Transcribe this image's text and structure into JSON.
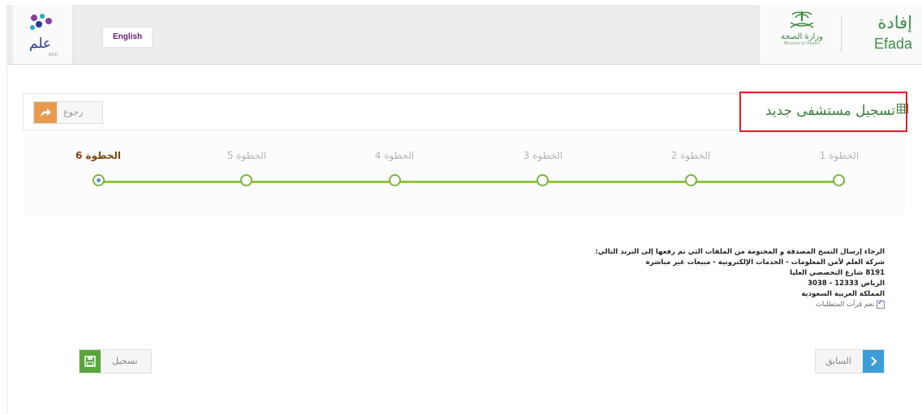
{
  "header": {
    "elm_logo_text": "علم",
    "elm_logo_sub": "elm",
    "language_button": "English",
    "moh_name_ar": "وزارة الصحة",
    "moh_name_en": "Ministry of Health",
    "efada_ar": "إفادة",
    "efada_en": "Efada"
  },
  "panel": {
    "title": "تسجيل مستشفى جديد",
    "back_label": "رجوع",
    "highlight_color": "#e0202a"
  },
  "stepper": {
    "steps": [
      {
        "label": "الخطوة 1",
        "state": "done"
      },
      {
        "label": "الخطوة 2",
        "state": "done"
      },
      {
        "label": "الخطوة 3",
        "state": "done"
      },
      {
        "label": "الخطوة 4",
        "state": "done"
      },
      {
        "label": "الخطوة 5",
        "state": "done"
      },
      {
        "label": "الخطوة 6",
        "state": "active"
      }
    ],
    "line_color": "#8cc63f"
  },
  "instructions": {
    "lines": [
      "الرجاء إرسال النسخ المصدقة و المختومة من الملفات التي تم رفعها إلى البريد التالي:",
      "شركة العلم لأمن المعلومات - الخدمات الإلكترونية - مبيعات غير مباشرة",
      "8191 شارع التخصصي العليا",
      "الرياض 12333 - 3038",
      "المملكة العربية السعودية"
    ],
    "checkbox_label": "نعم قرأت المتطلبات",
    "checkbox_checked": true
  },
  "actions": {
    "register_label": "تسجيل",
    "previous_label": "السابق"
  }
}
